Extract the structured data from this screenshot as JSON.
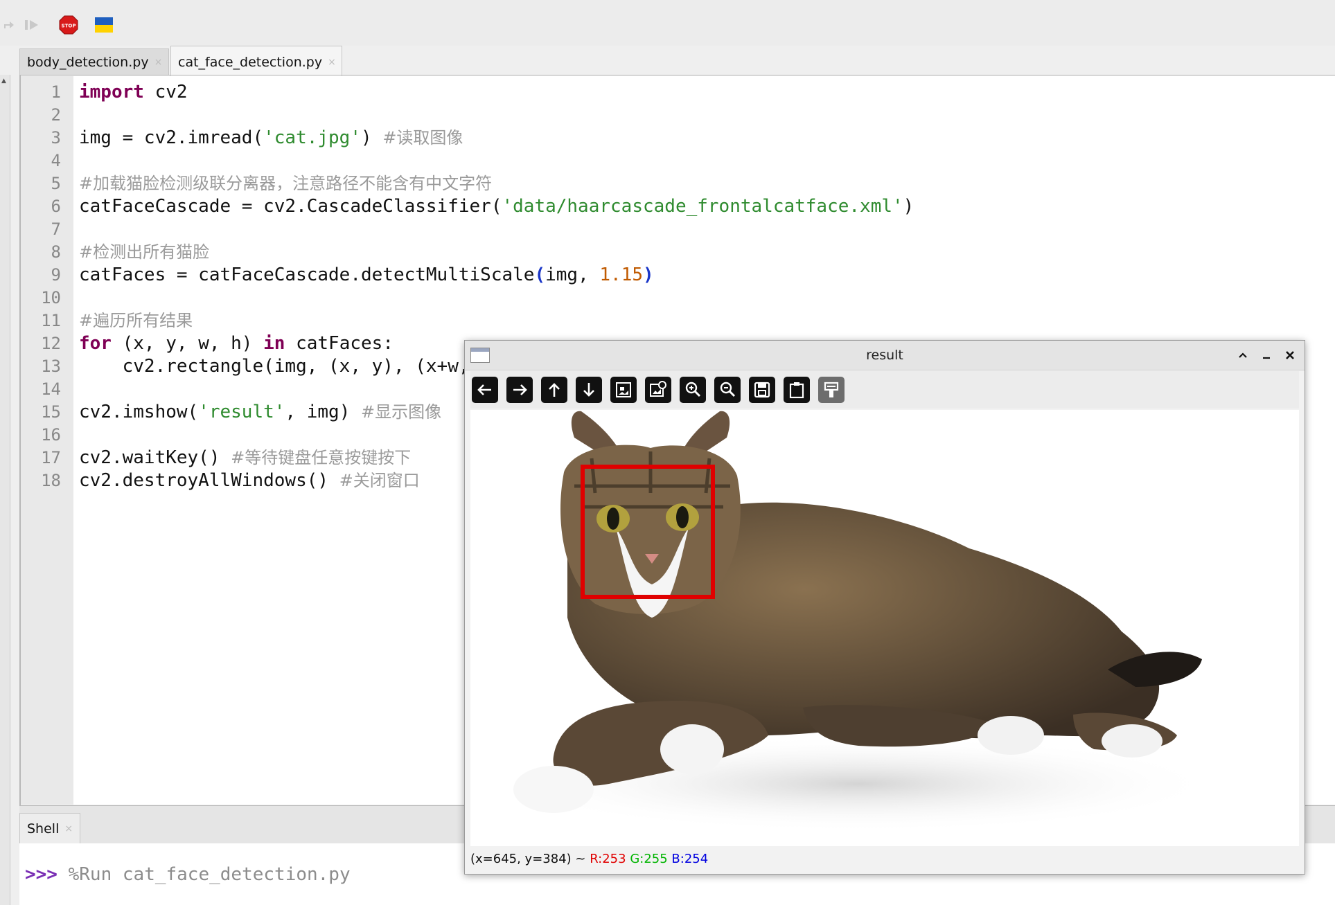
{
  "toolbar": {
    "icons": [
      "step-back-icon",
      "resume-icon",
      "stop-icon",
      "flag-icon"
    ]
  },
  "editor": {
    "tabs": [
      {
        "label": "body_detection.py",
        "active": false
      },
      {
        "label": "cat_face_detection.py",
        "active": true
      }
    ],
    "line_numbers": [
      "1",
      "2",
      "3",
      "4",
      "5",
      "6",
      "7",
      "8",
      "9",
      "10",
      "11",
      "12",
      "13",
      "14",
      "15",
      "16",
      "17",
      "18"
    ],
    "code": {
      "l1_kw": "import",
      "l1_rest": " cv2",
      "l3_a": "img = cv2.imread(",
      "l3_str": "'cat.jpg'",
      "l3_b": ") ",
      "l3_cmt": "#读取图像",
      "l5_cmt": "#加载猫脸检测级联分离器，注意路径不能含有中文字符",
      "l6_a": "catFaceCascade = cv2.CascadeClassifier(",
      "l6_str": "'data/haarcascade_frontalcatface.xml'",
      "l6_b": ")",
      "l8_cmt": "#检测出所有猫脸",
      "l9_a": "catFaces = catFaceCascade.detectMultiScale",
      "l9_p1": "(",
      "l9_b": "img, ",
      "l9_num": "1.15",
      "l9_p2": ")",
      "l11_cmt": "#遍历所有结果",
      "l12_kw": "for",
      "l12_a": " (x, y, w, h) ",
      "l12_kw2": "in",
      "l12_b": " catFaces:",
      "l13": "    cv2.rectangle(img, (x, y), (x+w,",
      "l15_a": "cv2.imshow(",
      "l15_str": "'result'",
      "l15_b": ", img) ",
      "l15_cmt": "#显示图像",
      "l17_a": "cv2.waitKey() ",
      "l17_cmt": "#等待键盘任意按键按下",
      "l18_a": "cv2.destroyAllWindows() ",
      "l18_cmt": "#关闭窗口"
    }
  },
  "shell": {
    "tab_label": "Shell",
    "prompt": ">>>",
    "command": " %Run cat_face_detection.py"
  },
  "result_window": {
    "title": "result",
    "tools": [
      "pan-left-icon",
      "pan-right-icon",
      "pan-up-icon",
      "pan-down-icon",
      "zoom-fit-icon",
      "zoom-original-icon",
      "zoom-in-icon",
      "zoom-out-icon",
      "save-icon",
      "copy-clipboard-icon",
      "properties-icon"
    ],
    "status_coords": "(x=645, y=384) ~ ",
    "status_r": "R:253",
    "status_g": "G:255",
    "status_b": "B:254",
    "detection_box_color": "#e00000"
  }
}
